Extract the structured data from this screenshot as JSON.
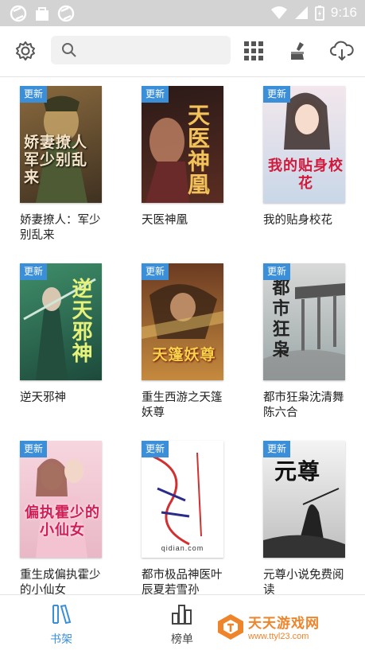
{
  "status_bar": {
    "time": "9:16",
    "icons": [
      "browser-icon",
      "shopping-bag-icon",
      "browser-icon",
      "wifi-icon",
      "signal-icon",
      "battery-charging-icon"
    ]
  },
  "toolbar": {
    "settings_icon": "gear-icon",
    "search_placeholder": "",
    "grid_icon": "grid-view-icon",
    "clean_icon": "broom-icon",
    "cloud_icon": "cloud-download-icon"
  },
  "badge_label": "更新",
  "books": [
    {
      "title": "娇妻撩人：军少别乱来",
      "cover_text": "娇妻撩人军少别乱来",
      "colors": [
        "#8a6a3e",
        "#3f3121"
      ]
    },
    {
      "title": "天医神凰",
      "cover_text": "天医神凰",
      "colors": [
        "#2b1a18",
        "#5a2d22"
      ]
    },
    {
      "title": "我的贴身校花",
      "cover_text": "我的贴身校花",
      "colors": [
        "#f3e7ec",
        "#c9d7e8"
      ]
    },
    {
      "title": "逆天邪神",
      "cover_text": "逆天邪神",
      "colors": [
        "#3f8e6a",
        "#1d4a3b"
      ]
    },
    {
      "title": "重生西游之天篷妖尊",
      "cover_text": "天篷妖尊",
      "colors": [
        "#6b3b22",
        "#c58a3e"
      ]
    },
    {
      "title": "都市狂枭沈清舞陈六合",
      "cover_text": "都市狂枭",
      "colors": [
        "#d9d9d9",
        "#9aa6a6"
      ]
    },
    {
      "title": "重生成偏执霍少的小仙女",
      "cover_text": "偏执霍少的小仙女",
      "colors": [
        "#f7d6df",
        "#e9b7c6"
      ]
    },
    {
      "title": "都市极品神医叶辰夏若雪孙",
      "cover_text": "qidian.com",
      "colors": [
        "#ffffff",
        "#f2f2f2"
      ]
    },
    {
      "title": "元尊小说免费阅读",
      "cover_text": "元尊",
      "colors": [
        "#f4f4f4",
        "#bdbdbd"
      ]
    }
  ],
  "tabs": [
    {
      "label": "书架",
      "icon": "bookshelf-icon",
      "active": true,
      "color": "#3b8fd9"
    },
    {
      "label": "榜单",
      "icon": "ranking-chart-icon",
      "active": false,
      "color": "#444444"
    }
  ],
  "watermark": {
    "title": "天天游戏网",
    "url": "www.ttyl23.com",
    "color": "#f0842a"
  }
}
